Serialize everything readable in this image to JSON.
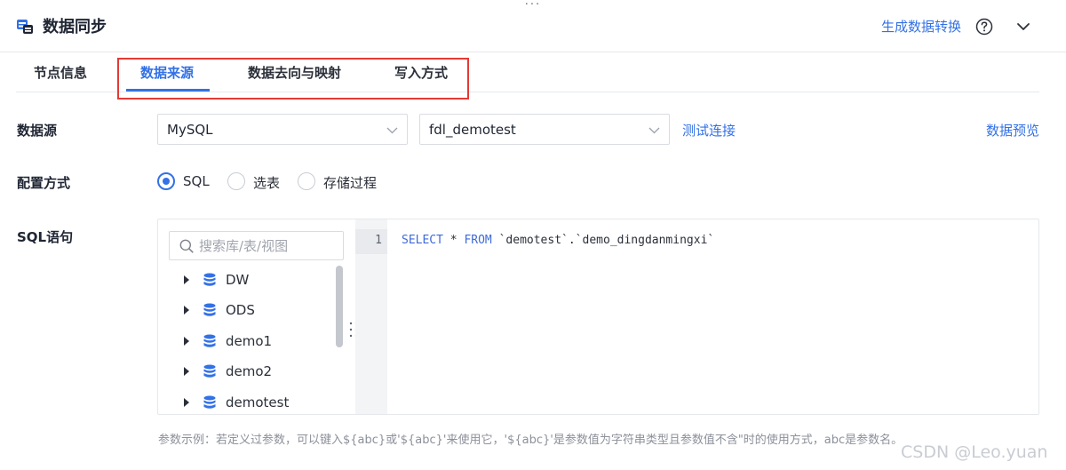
{
  "header": {
    "title": "数据同步",
    "generate_link": "生成数据转换",
    "icons": {
      "app": "database-sync-icon",
      "help": "question-circle-icon",
      "collapse": "chevron-down-icon"
    }
  },
  "tabs": [
    {
      "label": "节点信息",
      "active": false
    },
    {
      "label": "数据来源",
      "active": true
    },
    {
      "label": "数据去向与映射",
      "active": false
    },
    {
      "label": "写入方式",
      "active": false
    }
  ],
  "datasource": {
    "label": "数据源",
    "type_value": "MySQL",
    "connection_value": "fdl_demotest",
    "test_link": "测试连接",
    "preview_link": "数据预览"
  },
  "config": {
    "label": "配置方式",
    "options": [
      {
        "label": "SQL",
        "checked": true
      },
      {
        "label": "选表",
        "checked": false
      },
      {
        "label": "存储过程",
        "checked": false
      }
    ]
  },
  "sql": {
    "label": "SQL语句",
    "search_placeholder": "搜索库/表/视图",
    "tree": [
      "DW",
      "ODS",
      "demo1",
      "demo2",
      "demotest"
    ],
    "line_number": "1",
    "code": {
      "select": "SELECT",
      "star": " * ",
      "from": "FROM",
      "target": " `demotest`.`demo_dingdanmingxi`"
    }
  },
  "hint": "参数示例：若定义过参数，可以键入${abc}或'${abc}'来使用它，'${abc}'是参数值为字符串类型且参数值不含\"时的使用方式，abc是参数名。",
  "watermark": "CSDN @Leo.yuan",
  "drag_handle": "···",
  "colors": {
    "accent": "#3371e6",
    "highlight_box": "#e53935"
  }
}
